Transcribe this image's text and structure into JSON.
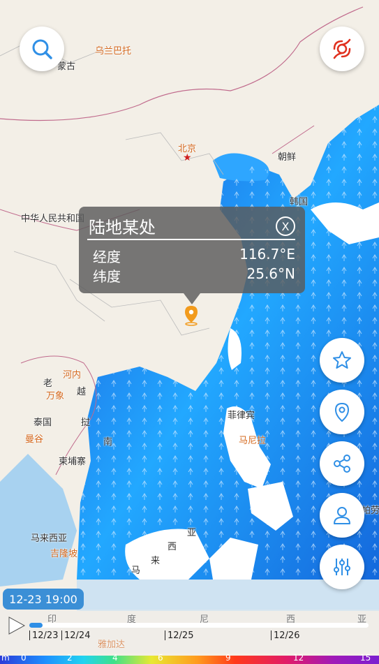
{
  "map_labels": {
    "mongolia_partial": "蒙古",
    "ulanbator": "乌兰巴托",
    "beijing": "北京",
    "korea_north": "朝鲜",
    "korea_south": "韩国",
    "china": "中华人民共和国",
    "hanoi": "河内",
    "laos": "老",
    "wanxiang": "万象",
    "yue": "越",
    "thailand": "泰国",
    "bangkok": "曼谷",
    "cambodia": "柬埔寨",
    "liao": "挝",
    "nan": "南",
    "philippines": "菲律宾",
    "manila": "马尼拉",
    "malaysia": "马来西亚",
    "kualalumpur": "吉隆坡",
    "xi": "西",
    "ya": "亚",
    "lai": "来",
    "ma": "马",
    "indo_1": "印",
    "indo_2": "度",
    "indo_3": "尼",
    "indo_4": "西",
    "indo_5": "亚",
    "jakarta": "雅加达",
    "palau_partial": "帕劳"
  },
  "popup": {
    "title": "陆地某处",
    "close": "X",
    "rows": [
      {
        "label": "经度",
        "value": "116.7°E"
      },
      {
        "label": "纬度",
        "value": "25.6°N"
      }
    ]
  },
  "time_badge": "12-23 19:00",
  "timeline": {
    "progress": 0.04,
    "ticks": [
      "12/23",
      "12/24",
      "12/25",
      "12/26"
    ]
  },
  "legend": {
    "labels": [
      "m",
      "0",
      "2",
      "4",
      "6",
      "9",
      "12",
      "15"
    ]
  },
  "colors": {
    "ocean_wave": "#1e78e6",
    "accent": "#2f8fe6",
    "typhoon_icon": "#e0301e"
  },
  "icons": {
    "search": "search-icon",
    "typhoon": "typhoon-icon",
    "star": "star-icon",
    "location": "location-pin-icon",
    "share": "share-icon",
    "user": "user-icon",
    "settings": "sliders-icon",
    "play": "play-icon"
  }
}
